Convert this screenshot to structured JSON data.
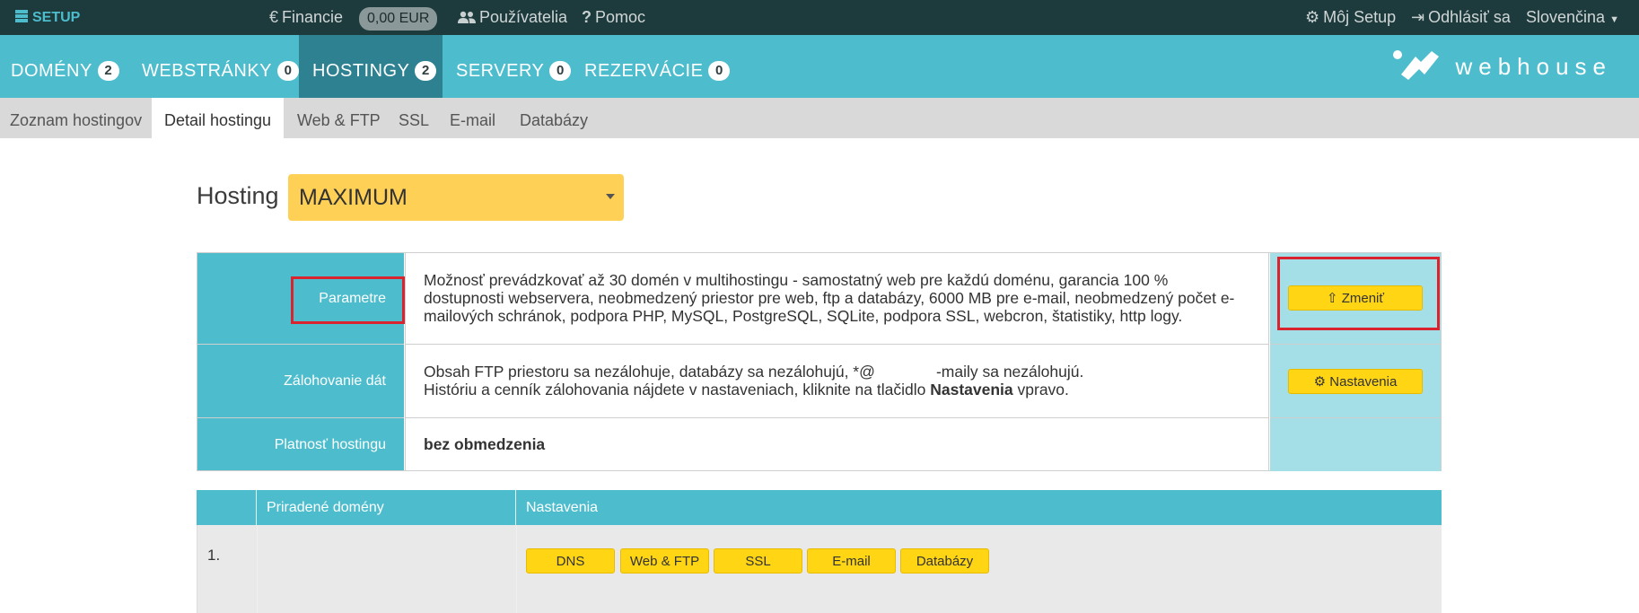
{
  "topbar": {
    "brand": "SETUP",
    "financie": "Financie",
    "balance": "0,00 EUR",
    "users": "Používatelia",
    "help": "Pomoc",
    "my_setup": "Môj Setup",
    "logout": "Odhlásiť sa",
    "language": "Slovenčina"
  },
  "mainnav": {
    "tabs": [
      {
        "label": "DOMÉNY",
        "count": "2"
      },
      {
        "label": "WEBSTRÁNKY",
        "count": "0"
      },
      {
        "label": "HOSTINGY",
        "count": "2"
      },
      {
        "label": "SERVERY",
        "count": "0"
      },
      {
        "label": "REZERVÁCIE",
        "count": "0"
      }
    ],
    "logo": "webhouse"
  },
  "subnav": {
    "tabs": [
      "Zoznam hostingov",
      "Detail hostingu",
      "Web & FTP",
      "SSL",
      "E-mail",
      "Databázy"
    ]
  },
  "hosting": {
    "label": "Hosting",
    "selected": "MAXIMUM"
  },
  "info": {
    "params_label": "Parametre",
    "params_text": "Možnosť prevádzkovať až 30 domén v multihostingu - samostatný web pre každú doménu, garancia 100 % dostupnosti webservera, neobmedzený priestor pre web, ftp a databázy, 6000 MB pre e-mail, neobmedzený počet e-mailových schránok, podpora PHP, MySQL, PostgreSQL, SQLite, podpora SSL, webcron, štatistiky, http logy.",
    "change_button": "Zmeniť",
    "backup_label": "Zálohovanie dát",
    "backup_line1": "Obsah FTP priestoru sa nezálohuje, databázy sa nezálohujú, *@              -maily sa nezálohujú.",
    "backup_line2_pre": "Históriu a cenník zálohovania nájdete v nastaveniach, kliknite na tlačidlo ",
    "backup_line2_bold": "Nastavenia",
    "backup_line2_post": " vpravo.",
    "settings_button": "Nastavenia",
    "validity_label": "Platnosť hostingu",
    "validity_value": "bez obmedzenia"
  },
  "domains": {
    "col_domains": "Priradené domény",
    "col_settings": "Nastavenia",
    "rows": [
      {
        "index": "1.",
        "domain": "",
        "buttons": [
          "DNS",
          "Web & FTP",
          "SSL",
          "E-mail",
          "Databázy"
        ]
      }
    ]
  },
  "colors": {
    "teal": "#4dbdce",
    "dark_teal": "#2e8190",
    "yellow": "#ffd514",
    "highlight_red": "#d9232e"
  }
}
